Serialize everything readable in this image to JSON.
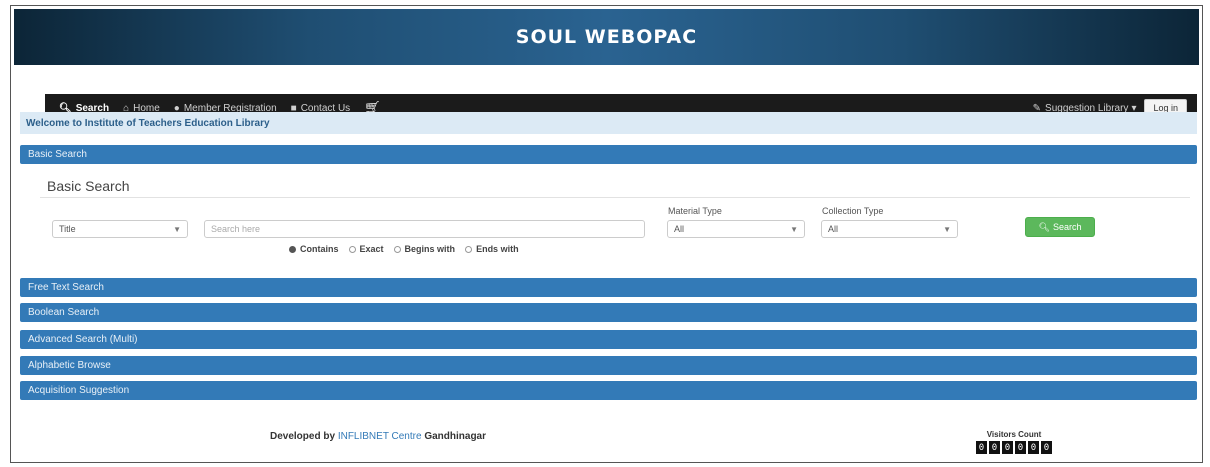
{
  "app": {
    "title": "SOUL WEBOPAC"
  },
  "nav": {
    "items": [
      {
        "icon": "search-icon",
        "label": "Search",
        "active": true
      },
      {
        "icon": "home-icon",
        "label": "Home",
        "active": false
      },
      {
        "icon": "user-icon",
        "label": "Member Registration",
        "active": false
      },
      {
        "icon": "contact-icon",
        "label": "Contact Us",
        "active": false
      },
      {
        "icon": "cart-icon",
        "label": "",
        "active": false
      }
    ],
    "right_label": "Suggestion Library",
    "login_label": "Log in"
  },
  "welcome": "Welcome to Institute of Teachers Education Library",
  "panels": {
    "basic_head": "Basic Search",
    "basic_title": "Basic Search",
    "collapsed": [
      "Free Text Search",
      "Boolean Search",
      "Advanced Search (Multi)",
      "Alphabetic Browse",
      "Acquisition Suggestion"
    ]
  },
  "basic_search": {
    "field_value": "Title",
    "search_placeholder": "Search here",
    "material_type_label": "Material Type",
    "material_type_value": "All",
    "collection_type_label": "Collection Type",
    "collection_type_value": "All",
    "search_button": "Search",
    "radio_options": [
      "Contains",
      "Exact",
      "Begins with",
      "Ends with"
    ],
    "radio_selected": "Contains"
  },
  "footer": {
    "developed_prefix": "Developed by",
    "developed_link": "INFLIBNET Centre",
    "developed_suffix": "Gandhinagar",
    "visitors_label": "Visitors Count",
    "visitors_digits": [
      "0",
      "0",
      "0",
      "0",
      "0",
      "0"
    ]
  }
}
